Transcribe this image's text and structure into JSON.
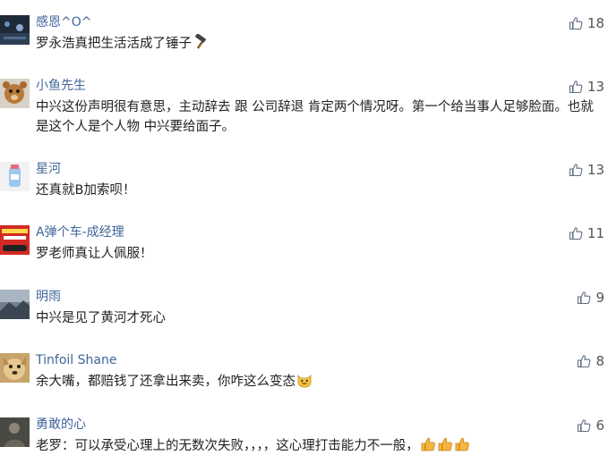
{
  "colors": {
    "username": "#406599",
    "text": "#222222",
    "like_count": "#555555"
  },
  "comments": [
    {
      "username": "感恩^O^",
      "text": "罗永浩真把生活活成了锤子",
      "trailing_emoji": "hammer-emoji",
      "likes": "18"
    },
    {
      "username": "小鱼先生",
      "text": "中兴这份声明很有意思，主动辞去 跟 公司辞退 肯定两个情况呀。第一个给当事人足够脸面。也就是这个人是个人物 中兴要给面子。",
      "likes": "13"
    },
    {
      "username": "星河",
      "text": "还真就B加索呗！",
      "likes": "13"
    },
    {
      "username": "A弹个车-成经理",
      "text": "罗老师真让人佩服！",
      "likes": "11"
    },
    {
      "username": "明雨",
      "text": "中兴是见了黄河才死心",
      "likes": "9"
    },
    {
      "username": "Tinfoil Shane",
      "text": "余大嘴，都赔钱了还拿出来卖，你咋这么变态",
      "trailing_emoji": "grinning-cat-emoji",
      "likes": "8"
    },
    {
      "username": "勇敢的心",
      "text": "老罗：可以承受心理上的无数次失败，，，，这心理打击能力不一般，",
      "trailing_emoji": "thumbs-up-emoji-x3",
      "likes": "6"
    }
  ]
}
